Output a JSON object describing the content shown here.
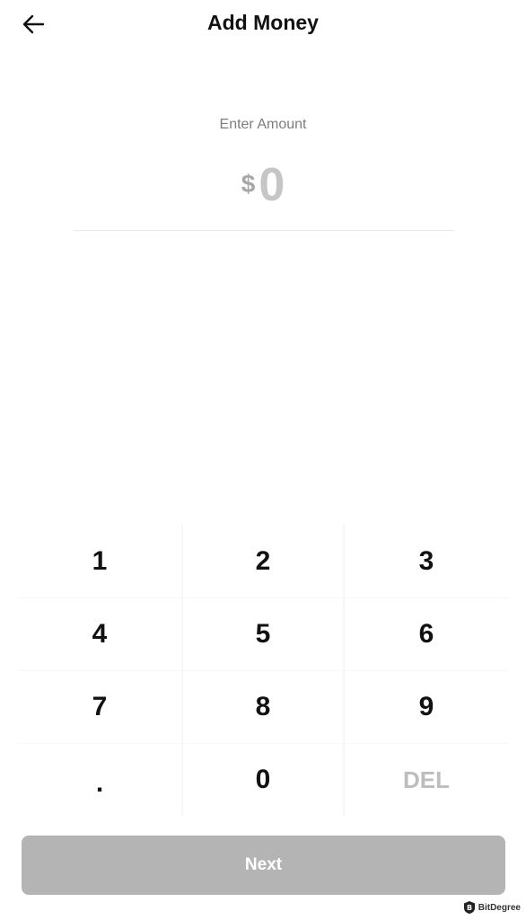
{
  "header": {
    "back_icon": "arrow-left-icon",
    "title": "Add Money"
  },
  "amount": {
    "label": "Enter Amount",
    "currency_symbol": "$",
    "value": "0"
  },
  "keypad": {
    "keys": [
      "1",
      "2",
      "3",
      "4",
      "5",
      "6",
      "7",
      "8",
      "9",
      ".",
      "0",
      "DEL"
    ]
  },
  "footer": {
    "next_label": "Next"
  },
  "watermark": {
    "text": "BitDegree",
    "icon": "bitdegree-logo-icon"
  },
  "colors": {
    "background": "#ffffff",
    "title": "#111111",
    "label": "#7d7d7d",
    "amount_placeholder": "#c6c6c6",
    "next_button_disabled": "#b4b4b4",
    "del_text": "#bdbdbd"
  }
}
